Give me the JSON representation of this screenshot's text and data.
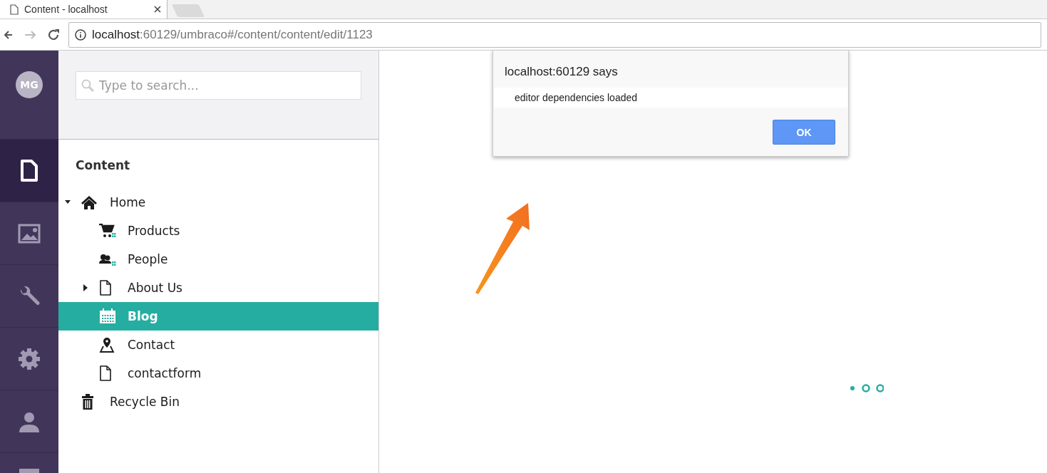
{
  "browser": {
    "tab_title": "Content - localhost",
    "url": {
      "host": "localhost",
      "path": ":60129/umbraco#/content/content/edit/1123"
    }
  },
  "sections": [
    {
      "kind": "avatar",
      "label": "MG",
      "selected": false
    },
    {
      "kind": "content",
      "selected": true
    },
    {
      "kind": "media",
      "selected": false
    },
    {
      "kind": "settings",
      "selected": false
    },
    {
      "kind": "developer",
      "selected": false
    },
    {
      "kind": "users",
      "selected": false
    },
    {
      "kind": "more",
      "selected": false
    }
  ],
  "search": {
    "placeholder": "Type to search..."
  },
  "tree": {
    "title": "Content",
    "items": [
      {
        "label": "Home",
        "kind": "home",
        "expanded": true,
        "selected": false,
        "children": [
          {
            "label": "Products",
            "kind": "cart",
            "selected": false
          },
          {
            "label": "People",
            "kind": "people",
            "selected": false
          },
          {
            "label": "About Us",
            "kind": "document",
            "expanded": false,
            "selected": false
          },
          {
            "label": "Blog",
            "kind": "calendar",
            "selected": true
          },
          {
            "label": "Contact",
            "kind": "pin",
            "selected": false
          },
          {
            "label": "contactform",
            "kind": "document",
            "selected": false
          }
        ]
      },
      {
        "label": "Recycle Bin",
        "kind": "trash",
        "selected": false
      }
    ]
  },
  "dialog": {
    "title": "localhost:60129 says",
    "message": "editor dependencies loaded",
    "button": "OK"
  }
}
